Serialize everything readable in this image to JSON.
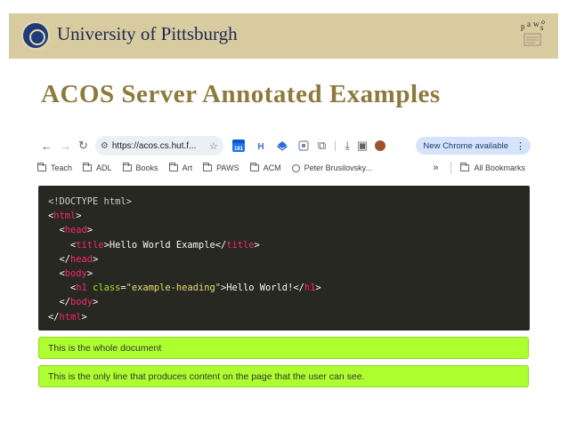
{
  "header": {
    "university": "University of Pittsburgh"
  },
  "slide": {
    "title": "ACOS Server Annotated Examples"
  },
  "browser": {
    "url": "https://acos.cs.hut.f...",
    "calendar_day": "181",
    "new_chrome_label": "New Chrome available",
    "bookmarks": [
      "Teach",
      "ADL",
      "Books",
      "Art",
      "PAWS",
      "ACM",
      "Peter Brusilovsky..."
    ],
    "all_bookmarks": "All Bookmarks"
  },
  "code": {
    "l1_doctype": "<!DOCTYPE html>",
    "lt": "<",
    "lt_slash": "</",
    "gt": ">",
    "tag_html": "html",
    "tag_head": "head",
    "tag_title": "title",
    "tag_body": "body",
    "tag_h1": "h1",
    "title_text": "Hello World Example",
    "attr_class": "class",
    "eq": "=",
    "class_value": "\"example-heading\"",
    "h1_text": "Hello World!"
  },
  "annotations": [
    "This is the whole document",
    "This is the only line that produces content on the page that the user can see."
  ]
}
